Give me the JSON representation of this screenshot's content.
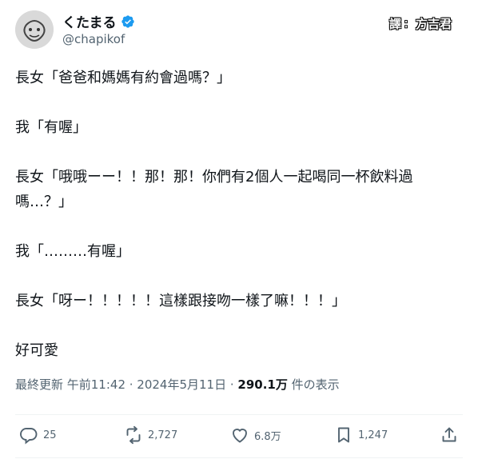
{
  "header": {
    "display_name": "くたまる",
    "handle": "@chapikof",
    "watermark_left": "譯",
    "watermark_sep": "：",
    "watermark_right": "方吉君"
  },
  "tweet": {
    "lines": [
      "長女「爸爸和媽媽有約會過嗎？」",
      "",
      "我「有喔」",
      "",
      "長女「哦哦ーー！！那！那！你們有2個人一起喝同一杯飲料過",
      "嗎…？」",
      "",
      "我「………有喔」",
      "",
      "長女「呀ー！！！！！這樣跟接吻一樣了嘛！！！」",
      "",
      "好可愛"
    ]
  },
  "meta": {
    "time": "最終更新 午前11:42 · 2024年5月11日 · ",
    "views": "290.1万",
    "views_suffix": " 件の表示"
  },
  "actions": {
    "replies": "25",
    "reposts": "2,727",
    "likes": "6.8万",
    "bookmarks": "1,247"
  },
  "colors": {
    "accent": "#1d9bf0",
    "muted": "#536471",
    "text": "#0f1419"
  },
  "icons": [
    "verified-badge-icon",
    "reply-icon",
    "repost-icon",
    "like-icon",
    "bookmark-icon",
    "share-icon"
  ]
}
